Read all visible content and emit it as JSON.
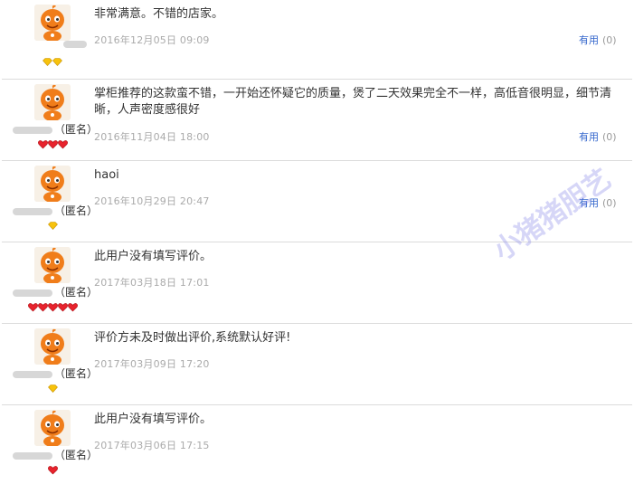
{
  "reviews": [
    {
      "content": "非常满意。不错的店家。",
      "date": "2016年12月05日 09:09",
      "user": "",
      "suffix": "",
      "badge_type": "diamond-yellow",
      "badge_count": 2,
      "useful_label": "有用",
      "useful_count": "(0)"
    },
    {
      "content": "掌柜推荐的这款蛮不错，一开始还怀疑它的质量，煲了二天效果完全不一样，高低音很明显，细节清晰，人声密度感很好",
      "date": "2016年11月04日 18:00",
      "user": "",
      "suffix": "（匿名）",
      "badge_type": "heart-red",
      "badge_count": 3,
      "useful_label": "有用",
      "useful_count": "(0)"
    },
    {
      "content": "haoi",
      "date": "2016年10月29日 20:47",
      "user": "",
      "suffix": "（匿名）",
      "badge_type": "diamond-yellow",
      "badge_count": 1,
      "useful_label": "有用",
      "useful_count": "(0)"
    },
    {
      "content": "此用户没有填写评价。",
      "date": "2017年03月18日 17:01",
      "user": "",
      "suffix": "（匿名）",
      "badge_type": "heart-red",
      "badge_count": 5,
      "useful_label": "",
      "useful_count": ""
    },
    {
      "content": "评价方未及时做出评价,系统默认好评!",
      "date": "2017年03月09日 17:20",
      "user": "",
      "suffix": "（匿名）",
      "badge_type": "diamond-yellow",
      "badge_count": 1,
      "useful_label": "",
      "useful_count": ""
    },
    {
      "content": "此用户没有填写评价。",
      "date": "2017年03月06日 17:15",
      "user": "",
      "suffix": "（匿名）",
      "badge_type": "heart-red",
      "badge_count": 1,
      "useful_label": "",
      "useful_count": ""
    }
  ],
  "watermark": "小猪猪胆艺",
  "colors": {
    "link": "#3366cc",
    "date": "#aaaaaa",
    "avatar": "#f07d1a",
    "heart": "#e8232d",
    "diamond": "#f7c20c"
  }
}
